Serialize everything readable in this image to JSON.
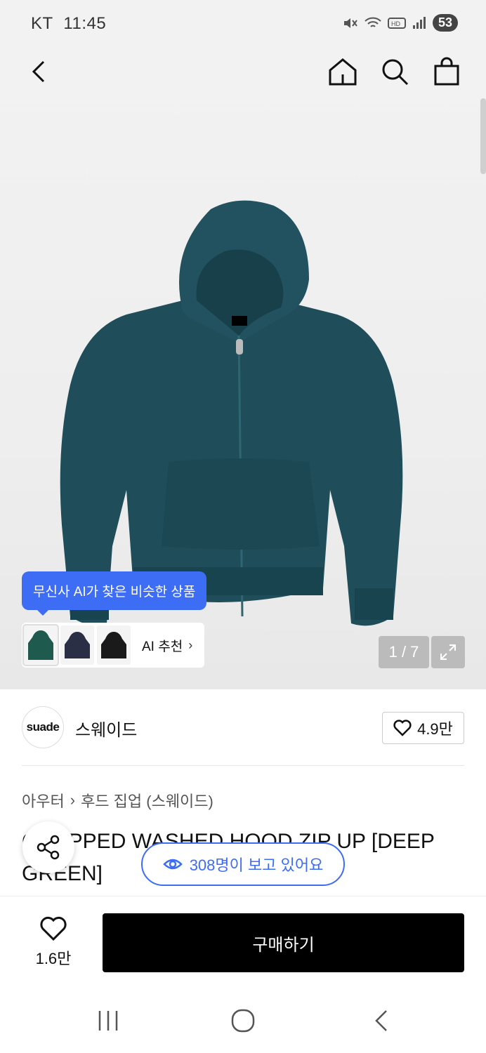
{
  "status_bar": {
    "carrier": "KT",
    "time": "11:45",
    "battery": "53"
  },
  "nav": {
    "back_icon": "chevron-left-icon",
    "home_icon": "home-icon",
    "search_icon": "search-icon",
    "cart_icon": "bag-icon"
  },
  "hero": {
    "image_counter": "1 / 7",
    "ai_tooltip": "무신사 AI가 찾은 비슷한 상품",
    "ai_recommend_label": "AI 추천",
    "chevron": "›"
  },
  "brand": {
    "logo_text": "suade",
    "name": "스웨이드",
    "likes": "4.9만"
  },
  "breadcrumb": {
    "category": "아우터",
    "separator": "›",
    "subcategory": "후드 집업 (스웨이드)"
  },
  "product": {
    "title": "CROPPED WASHED HOOD ZIP UP [DEEP GREEN]"
  },
  "viewers": {
    "text": "308명이 보고 있어요"
  },
  "bottom": {
    "like_count": "1.6만",
    "buy_label": "구매하기"
  },
  "colors": {
    "accent": "#3d6cf5",
    "hoodie": "#1f4e5a",
    "buy_bg": "#000000"
  }
}
